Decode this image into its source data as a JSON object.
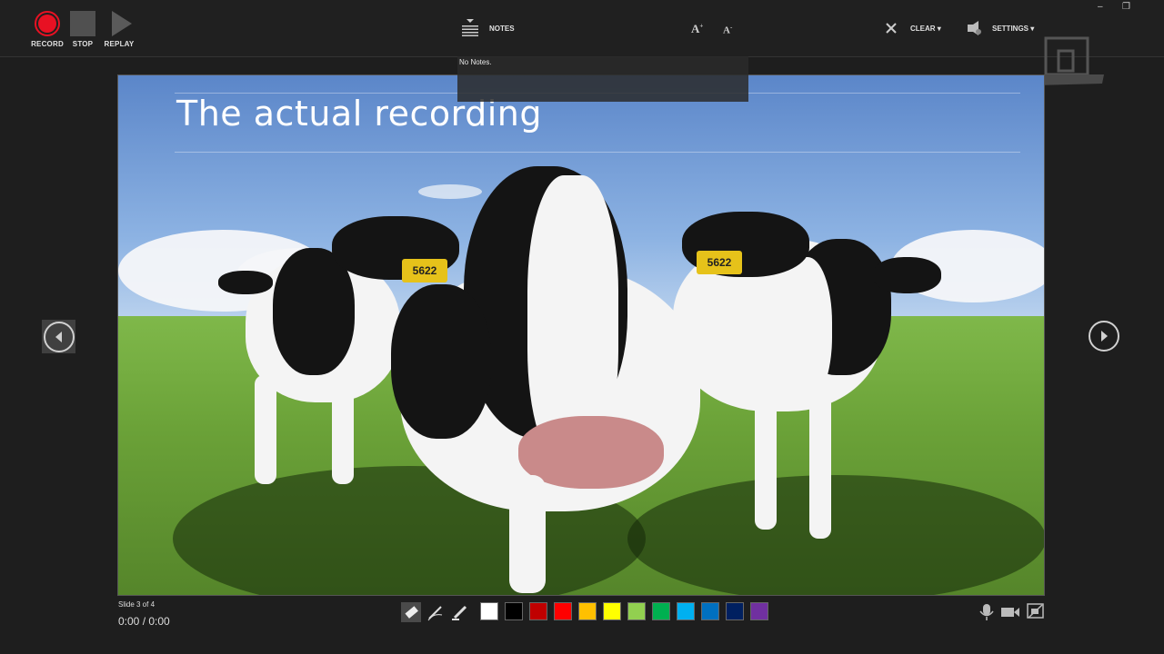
{
  "toolbar": {
    "record_label": "RECORD",
    "stop_label": "STOP",
    "replay_label": "REPLAY",
    "notes_label": "NOTES",
    "clear_label": "CLEAR ▾",
    "settings_label": "SETTINGS ▾",
    "font_increase_icon": "A",
    "font_decrease_icon": "A"
  },
  "window": {
    "minimize": "–",
    "restore": "❐"
  },
  "notes": {
    "text": "No Notes."
  },
  "slide": {
    "title": "The actual recording",
    "tag_text": "5622",
    "counter": "Slide 3 of 4"
  },
  "playback": {
    "timer": "0:00  /  0:00"
  },
  "ink": {
    "tools": [
      "eraser-icon",
      "pen-icon",
      "highlighter-icon"
    ],
    "colors": [
      "#ffffff",
      "#000000",
      "#c00000",
      "#ff0000",
      "#ffc000",
      "#ffff00",
      "#92d050",
      "#00b050",
      "#00b0f0",
      "#0070c0",
      "#002060",
      "#7030a0"
    ]
  },
  "media_icons": [
    "microphone-icon",
    "camera-icon",
    "camera-preview-icon"
  ],
  "colors": {
    "record": "#e81123",
    "background": "#1e1e1e"
  }
}
